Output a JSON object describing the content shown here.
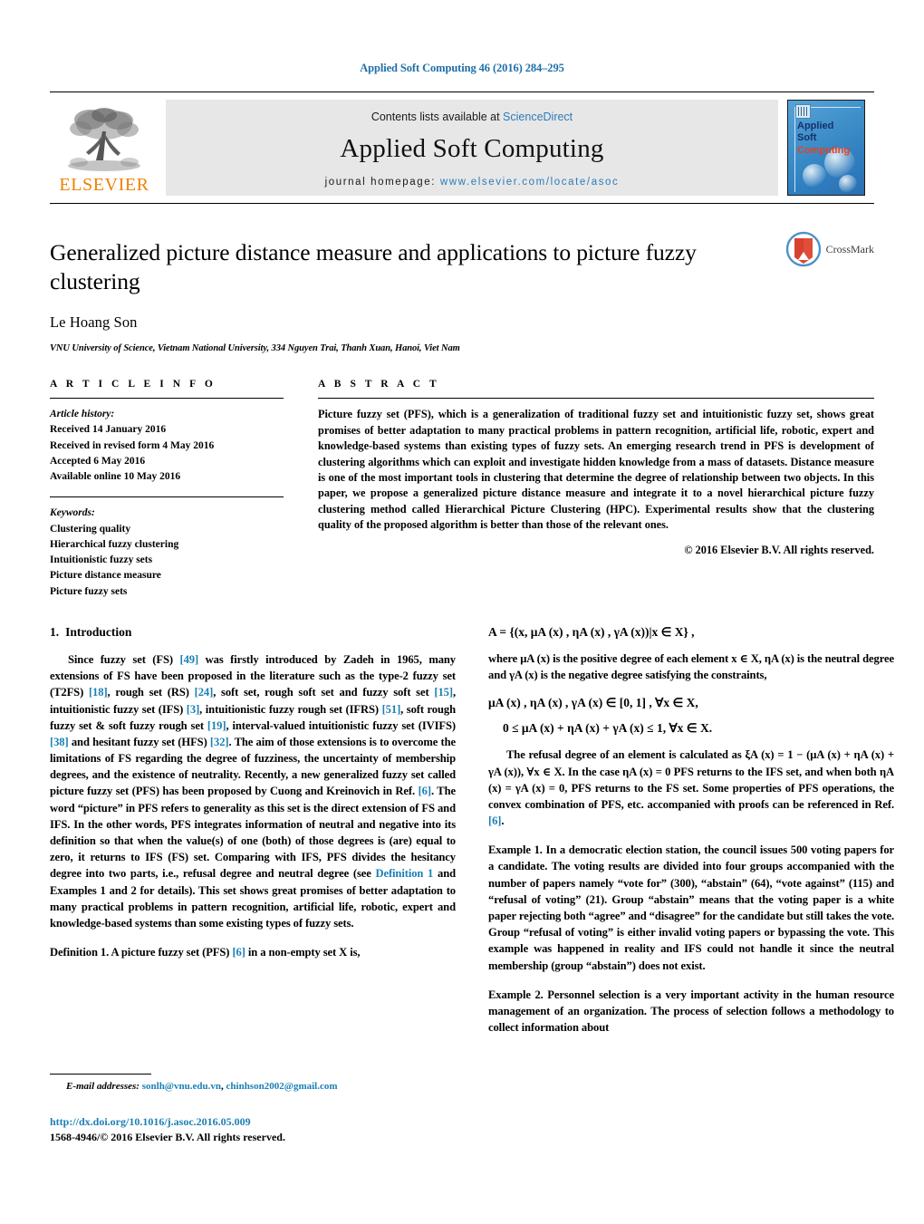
{
  "running_head": "Applied Soft Computing 46 (2016) 284–295",
  "masthead": {
    "publisher_name": "ELSEVIER",
    "contents_prefix": "Contents lists available at ",
    "contents_link": "ScienceDirect",
    "journal_title": "Applied Soft Computing",
    "homepage_label": "journal homepage:",
    "homepage_url": "www.elsevier.com/locate/asoc",
    "cover": {
      "line1": "Applied",
      "line2": "Soft",
      "line3": "Computing",
      "title_color": "#16306b",
      "accent_color": "#e8401f"
    }
  },
  "article": {
    "title": "Generalized picture distance measure and applications to picture fuzzy clustering",
    "author": "Le Hoang Son",
    "affiliation": "VNU University of Science, Vietnam National University, 334 Nguyen Trai, Thanh Xuan, Hanoi, Viet Nam",
    "crossmark_label": "CrossMark"
  },
  "article_info": {
    "heading": "A R T I C L E    I N F O",
    "history_label": "Article history:",
    "history": [
      "Received 14 January 2016",
      "Received in revised form 4 May 2016",
      "Accepted 6 May 2016",
      "Available online 10 May 2016"
    ],
    "keywords_label": "Keywords:",
    "keywords": [
      "Clustering quality",
      "Hierarchical fuzzy clustering",
      "Intuitionistic fuzzy sets",
      "Picture distance measure",
      "Picture fuzzy sets"
    ]
  },
  "abstract": {
    "heading": "A B S T R A C T",
    "text": "Picture fuzzy set (PFS), which is a generalization of traditional fuzzy set and intuitionistic fuzzy set, shows great promises of better adaptation to many practical problems in pattern recognition, artificial life, robotic, expert and knowledge-based systems than existing types of fuzzy sets. An emerging research trend in PFS is development of clustering algorithms which can exploit and investigate hidden knowledge from a mass of datasets. Distance measure is one of the most important tools in clustering that determine the degree of relationship between two objects. In this paper, we propose a generalized picture distance measure and integrate it to a novel hierarchical picture fuzzy clustering method called Hierarchical Picture Clustering (HPC). Experimental results show that the clustering quality of the proposed algorithm is better than those of the relevant ones.",
    "copyright": "© 2016 Elsevier B.V. All rights reserved."
  },
  "introduction": {
    "number": "1.",
    "title": "Introduction",
    "para1_a": "Since fuzzy set (FS) ",
    "cite49": "[49]",
    "para1_b": " was firstly introduced by Zadeh in 1965, many extensions of FS have been proposed in the literature such as the type-2 fuzzy set (T2FS) ",
    "cite18": "[18]",
    "para1_c": ", rough set (RS) ",
    "cite24": "[24]",
    "para1_d": ", soft set, rough soft set and fuzzy soft set ",
    "cite15": "[15]",
    "para1_e": ", intuitionistic fuzzy set (IFS) ",
    "cite3": "[3]",
    "para1_f": ", intuitionistic fuzzy rough set (IFRS) ",
    "cite51": "[51]",
    "para1_g": ", soft rough fuzzy set & soft fuzzy rough set ",
    "cite19": "[19]",
    "para1_h": ", interval-valued intuitionistic fuzzy set (IVIFS) ",
    "cite38": "[38]",
    "para1_i": " and hesitant fuzzy set (HFS) ",
    "cite32": "[32]",
    "para1_j": ". The aim of those extensions is to overcome the limitations of FS regarding the degree of fuzziness, the uncertainty of membership degrees, and the existence of neutrality. Recently, a new generalized fuzzy set called picture fuzzy set (PFS) has been proposed by Cuong and Kreinovich in Ref. ",
    "cite6_a": "[6]",
    "para1_k": ". The word “picture” in PFS refers to generality as this set is the direct extension of FS and IFS. In the other words, PFS integrates information of neutral and negative into its definition so that when the value(s) of one (both) of those degrees is (are) equal to zero, it returns to IFS (FS) set. Comparing with IFS, PFS divides the hesitancy degree into two parts, i.e., refusal degree and neutral degree (see ",
    "deflink": "Definition 1",
    "para1_l": " and Examples 1 and 2 for details). This set shows great promises of better adaptation to many practical problems in pattern recognition, artificial life, robotic, expert and knowledge-based systems than some existing types of fuzzy sets.",
    "definition_head": "Definition 1.",
    "definition_a": " A picture fuzzy set (PFS) ",
    "cite6_b": "[6]",
    "definition_b": " in a non-empty set X is,"
  },
  "right_column": {
    "eq_set": "A = {(x, μA (x) , ηA (x) , γA (x))|x ∈ X} ,",
    "where_text_a": "where ",
    "where_math1": "μA (x)",
    "where_text_b": " is the positive degree of each element ",
    "where_math2": "x ∈ X, ηA (x)",
    "where_text_c": " is the neutral degree and ",
    "where_math3": "γA (x)",
    "where_text_d": " is the negative degree satisfying the constraints,",
    "eq_range": "μA (x) , ηA (x) , γA (x) ∈ [0, 1] , ∀x ∈ X,",
    "eq_sum": "0 ≤ μA (x) + ηA (x) + γA (x) ≤ 1, ∀x ∈ X.",
    "refusal_text": "The refusal degree of an element is calculated as ξA (x) = 1 − (μA (x) + ηA (x) + γA (x)), ∀x ∈ X. In the case ηA (x) = 0 PFS returns to the IFS set, and when both ηA (x) = γA (x) = 0, PFS returns to the FS set. Some properties of PFS operations, the convex combination of PFS, etc. accompanied with proofs can be referenced in Ref. ",
    "cite6_c": "[6]",
    "refusal_text_end": ".",
    "example1_head": "Example 1.",
    "example1_text": " In a democratic election station, the council issues 500 voting papers for a candidate. The voting results are divided into four groups accompanied with the number of papers namely “vote for” (300), “abstain” (64), “vote against” (115) and “refusal of voting” (21). Group “abstain” means that the voting paper is a white paper rejecting both “agree” and “disagree” for the candidate but still takes the vote. Group “refusal of voting” is either invalid voting papers or bypassing the vote. This example was happened in reality and IFS could not handle it since the neutral membership (group “abstain”) does not exist.",
    "example2_head": "Example 2.",
    "example2_text": " Personnel selection is a very important activity in the human resource management of an organization. The process of selection follows a methodology to collect information about"
  },
  "footer": {
    "email_label": "E-mail addresses:",
    "email1": "sonlh@vnu.edu.vn",
    "email_sep": ", ",
    "email2": "chinhson2002@gmail.com",
    "email_end": "",
    "doi": "http://dx.doi.org/10.1016/j.asoc.2016.05.009",
    "issn": "1568-4946/© 2016 Elsevier B.V. All rights reserved."
  },
  "colors": {
    "link_blue": "#1a7fb5",
    "elsevier_orange": "#ef8200",
    "band_grey": "#e7e7e7"
  }
}
